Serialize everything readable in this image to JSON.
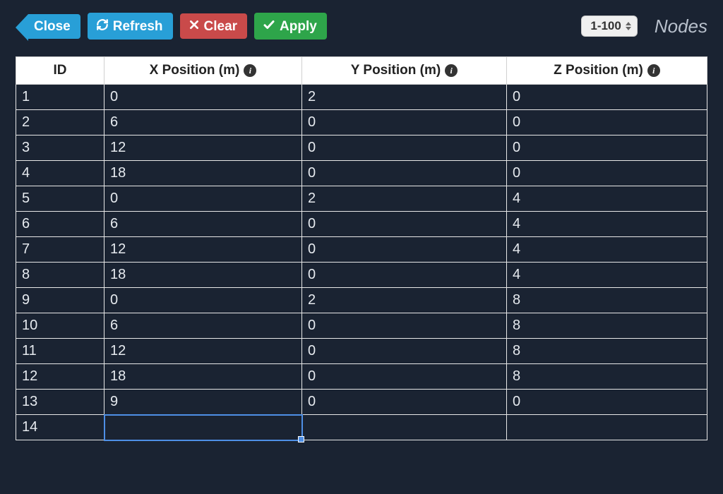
{
  "toolbar": {
    "close_label": "Close",
    "refresh_label": "Refresh",
    "clear_label": "Clear",
    "apply_label": "Apply",
    "range_label": "1-100"
  },
  "page_title": "Nodes",
  "table": {
    "columns": {
      "id": "ID",
      "x": "X Position (m)",
      "y": "Y Position (m)",
      "z": "Z Position (m)"
    },
    "rows": [
      {
        "id": "1",
        "x": "0",
        "y": "2",
        "z": "0"
      },
      {
        "id": "2",
        "x": "6",
        "y": "0",
        "z": "0"
      },
      {
        "id": "3",
        "x": "12",
        "y": "0",
        "z": "0"
      },
      {
        "id": "4",
        "x": "18",
        "y": "0",
        "z": "0"
      },
      {
        "id": "5",
        "x": "0",
        "y": "2",
        "z": "4"
      },
      {
        "id": "6",
        "x": "6",
        "y": "0",
        "z": "4"
      },
      {
        "id": "7",
        "x": "12",
        "y": "0",
        "z": "4"
      },
      {
        "id": "8",
        "x": "18",
        "y": "0",
        "z": "4"
      },
      {
        "id": "9",
        "x": "0",
        "y": "2",
        "z": "8"
      },
      {
        "id": "10",
        "x": "6",
        "y": "0",
        "z": "8"
      },
      {
        "id": "11",
        "x": "12",
        "y": "0",
        "z": "8"
      },
      {
        "id": "12",
        "x": "18",
        "y": "0",
        "z": "8"
      },
      {
        "id": "13",
        "x": "9",
        "y": "0",
        "z": "0"
      },
      {
        "id": "14",
        "x": "",
        "y": "",
        "z": ""
      }
    ],
    "selected_cell": {
      "row_index": 13,
      "col": "x"
    }
  },
  "colors": {
    "bg": "#1a2332",
    "btn_blue": "#289fd7",
    "btn_red": "#c94a4a",
    "btn_green": "#2ea54a",
    "selection": "#4e8fe6"
  }
}
